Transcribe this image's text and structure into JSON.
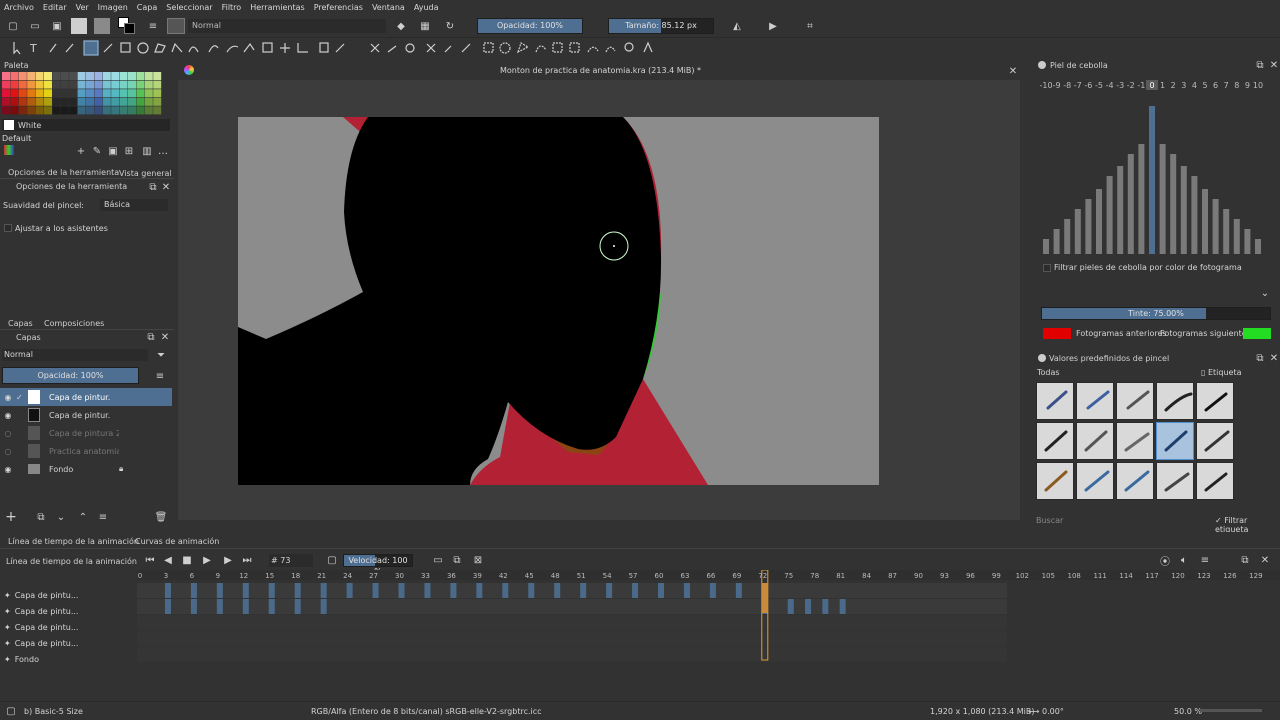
{
  "menu": [
    "Archivo",
    "Editar",
    "Ver",
    "Imagen",
    "Capa",
    "Seleccionar",
    "Filtro",
    "Herramientas",
    "Preferencias",
    "Ventana",
    "Ayuda"
  ],
  "toolbar": {
    "blend_mode": "Normal",
    "opacity": "Opacidad: 100%",
    "size": "Tamaño: 85.12 px"
  },
  "palette": {
    "title": "Paleta",
    "color_name": "White",
    "palette_name": "Default"
  },
  "tool_options": {
    "tab_tool": "Opciones de la herramienta",
    "tab_overview": "Vista general",
    "title": "Opciones de la herramienta",
    "smoothing_label": "Suavidad del pincel:",
    "smoothing_value": "Básica",
    "assistants": "Ajustar a los asistentes"
  },
  "layers": {
    "tab_layers": "Capas",
    "tab_compositions": "Composiciones",
    "title": "Capas",
    "blend": "Normal",
    "opacity": "Opacidad: 100%",
    "items": [
      {
        "name": "Capa de pintur..."
      },
      {
        "name": "Capa de pintur..."
      },
      {
        "name": "Capa de pintura 2"
      },
      {
        "name": "Practica anatomia ..."
      },
      {
        "name": "Fondo"
      }
    ]
  },
  "document": {
    "title": "Monton de practica de anatomia.kra (213.4 MiB) *"
  },
  "onion": {
    "title": "Piel de cebolla",
    "labels": [
      "-10",
      "-9",
      "-8",
      "-7",
      "-6",
      "-5",
      "-4",
      "-3",
      "-2",
      "-1",
      "0",
      "1",
      "2",
      "3",
      "4",
      "5",
      "6",
      "7",
      "8",
      "9",
      "10"
    ],
    "filter_label": "Filtrar pieles de cebolla por color de fotograma",
    "tint": "Tinte: 75.00%",
    "prev": "Fotogramas anteriores",
    "next": "Fotogramas siguientes",
    "prev_color": "#e00000",
    "next_color": "#22dd22"
  },
  "presets": {
    "title": "Valores predefinidos de pincel",
    "filter": "Todas",
    "tag": "Etiqueta",
    "search_placeholder": "Buscar",
    "filter_tag": "Filtrar etiqueta"
  },
  "timeline": {
    "tab_timeline": "Línea de tiempo de la animación",
    "tab_curves": "Curvas de animación",
    "title": "Línea de tiempo de la animación",
    "frame": "73",
    "speed_label": "Velocidad: 100 %",
    "ruler": [
      "0",
      "3",
      "6",
      "9",
      "12",
      "15",
      "18",
      "21",
      "24",
      "27",
      "30",
      "33",
      "36",
      "39",
      "42",
      "45",
      "48",
      "51",
      "54",
      "57",
      "60",
      "63",
      "66",
      "69",
      "72",
      "75",
      "78",
      "81",
      "84",
      "87",
      "90",
      "93",
      "96",
      "99",
      "102",
      "105",
      "108",
      "111",
      "114",
      "117",
      "120",
      "123",
      "126",
      "129"
    ],
    "rows": [
      {
        "name": "Capa de pintu..."
      },
      {
        "name": "Capa de pintu..."
      },
      {
        "name": "Capa de pintu..."
      },
      {
        "name": "Capa de pintu..."
      },
      {
        "name": "Fondo"
      }
    ]
  },
  "status": {
    "brush": "b) Basic-5 Size",
    "colorspace": "RGB/Alfa (Entero de 8 bits/canal)  sRGB-elle-V2-srgbtrc.icc",
    "dims": "1,920 x 1,080 (213.4 MiB)",
    "rotation": "0.00°",
    "zoom": "50.0 %"
  }
}
